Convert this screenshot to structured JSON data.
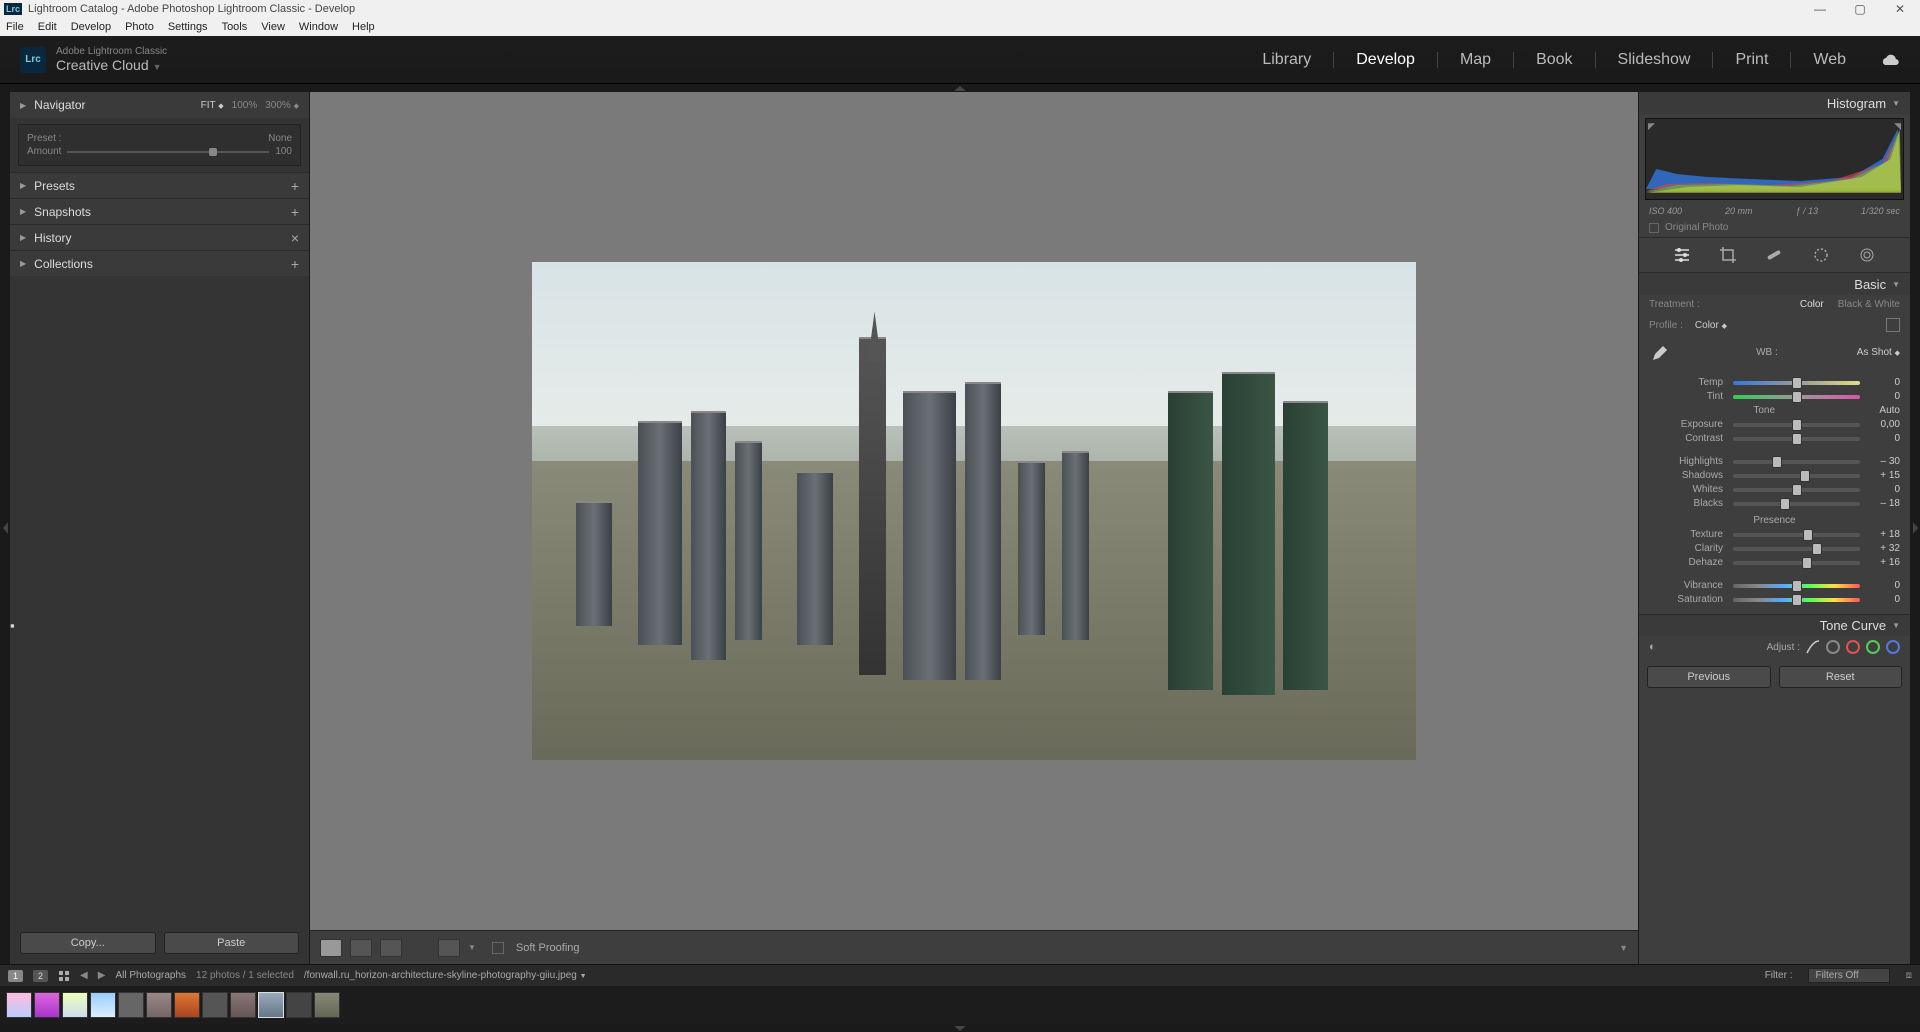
{
  "titlebar": {
    "badge": "Lrc",
    "title": "Lightroom Catalog - Adobe Photoshop Lightroom Classic - Develop"
  },
  "menubar": [
    "File",
    "Edit",
    "Develop",
    "Photo",
    "Settings",
    "Tools",
    "View",
    "Window",
    "Help"
  ],
  "topbar": {
    "logo": "Lrc",
    "brand_sub": "Adobe Lightroom Classic",
    "brand_main": "Creative Cloud"
  },
  "modules": [
    "Library",
    "Develop",
    "Map",
    "Book",
    "Slideshow",
    "Print",
    "Web"
  ],
  "modules_active": "Develop",
  "left": {
    "navigator": {
      "label": "Navigator",
      "fit": "FIT",
      "z1": "100%",
      "z2": "300%"
    },
    "preset_box": {
      "preset_lbl": "Preset :",
      "preset_val": "None",
      "amount_lbl": "Amount",
      "amount_val": "100"
    },
    "sections": [
      {
        "label": "Presets",
        "act": "+"
      },
      {
        "label": "Snapshots",
        "act": "+"
      },
      {
        "label": "History",
        "act": "×"
      },
      {
        "label": "Collections",
        "act": "+"
      }
    ],
    "copy": "Copy...",
    "paste": "Paste"
  },
  "center_toolbar": {
    "soft_proofing": "Soft Proofing"
  },
  "right": {
    "histogram_label": "Histogram",
    "exif": {
      "iso": "ISO 400",
      "focal": "20 mm",
      "aperture": "ƒ / 13",
      "shutter": "1/320 sec"
    },
    "original": "Original Photo",
    "basic_label": "Basic",
    "treatment": {
      "lbl": "Treatment :",
      "color": "Color",
      "bw": "Black & White"
    },
    "profile": {
      "lbl": "Profile :",
      "val": "Color"
    },
    "wb": {
      "lbl": "WB :",
      "val": "As Shot"
    },
    "tone_label": "Tone",
    "auto": "Auto",
    "presence_label": "Presence",
    "sliders": {
      "temp": {
        "lbl": "Temp",
        "val": "0",
        "pos": 50
      },
      "tint": {
        "lbl": "Tint",
        "val": "0",
        "pos": 50
      },
      "exposure": {
        "lbl": "Exposure",
        "val": "0,00",
        "pos": 50
      },
      "contrast": {
        "lbl": "Contrast",
        "val": "0",
        "pos": 50
      },
      "highlights": {
        "lbl": "Highlights",
        "val": "– 30",
        "pos": 35
      },
      "shadows": {
        "lbl": "Shadows",
        "val": "+ 15",
        "pos": 57
      },
      "whites": {
        "lbl": "Whites",
        "val": "0",
        "pos": 50
      },
      "blacks": {
        "lbl": "Blacks",
        "val": "– 18",
        "pos": 41
      },
      "texture": {
        "lbl": "Texture",
        "val": "+ 18",
        "pos": 59
      },
      "clarity": {
        "lbl": "Clarity",
        "val": "+ 32",
        "pos": 66
      },
      "dehaze": {
        "lbl": "Dehaze",
        "val": "+ 16",
        "pos": 58
      },
      "vibrance": {
        "lbl": "Vibrance",
        "val": "0",
        "pos": 50
      },
      "saturation": {
        "lbl": "Saturation",
        "val": "0",
        "pos": 50
      }
    },
    "tone_curve": "Tone Curve",
    "adjust": "Adjust :",
    "previous": "Previous",
    "reset": "Reset"
  },
  "filmstrip_bar": {
    "badge1": "1",
    "badge2": "2",
    "source": "All Photographs",
    "count": "12 photos / 1 selected",
    "filename": "/fonwall.ru_horizon-architecture-skyline-photography-giiu.jpeg",
    "filter_lbl": "Filter :",
    "filter_val": "Filters Off"
  }
}
